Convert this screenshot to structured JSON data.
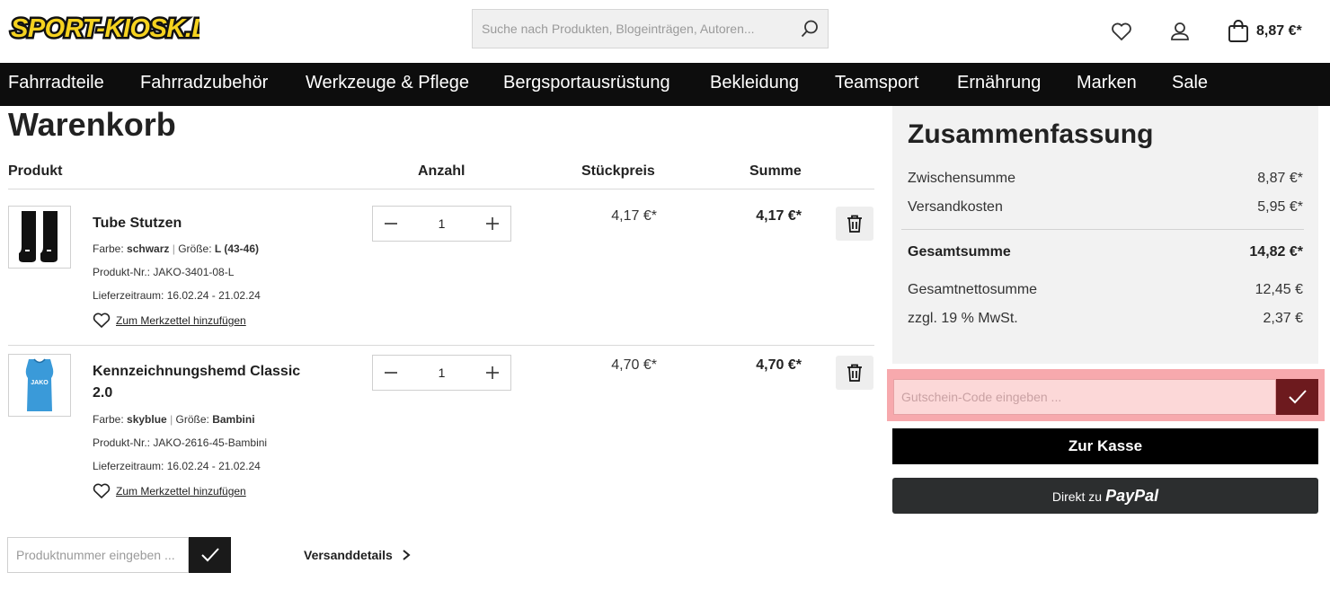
{
  "header": {
    "logo_text": "SPORT-KIOSK.DE",
    "search_placeholder": "Suche nach Produkten, Blogeinträgen, Autoren...",
    "cart_amount": "8,87 €*"
  },
  "nav": {
    "items": [
      "Fahrradteile",
      "Fahrradzubehör",
      "Werkzeuge & Pflege",
      "Bergsportausrüstung",
      "Bekleidung",
      "Teamsport",
      "Ernährung",
      "Marken",
      "Sale"
    ]
  },
  "cart": {
    "title": "Warenkorb",
    "columns": {
      "product": "Produkt",
      "quantity": "Anzahl",
      "unit_price": "Stückpreis",
      "total": "Summe"
    },
    "items": [
      {
        "name": "Tube Stutzen",
        "color_label": "Farbe:",
        "color": "schwarz",
        "size_label": "Größe:",
        "size": "L (43-46)",
        "product_no": "Produkt-Nr.: JAKO-3401-08-L",
        "delivery": "Lieferzeitraum: 16.02.24 - 21.02.24",
        "wishlist": "Zum Merkzettel hinzufügen",
        "quantity": "1",
        "unit_price": "4,17 €*",
        "total": "4,17 €*"
      },
      {
        "name": "Kennzeichnungshemd Classic 2.0",
        "color_label": "Farbe:",
        "color": "skyblue",
        "size_label": "Größe:",
        "size": "Bambini",
        "product_no": "Produkt-Nr.: JAKO-2616-45-Bambini",
        "delivery": "Lieferzeitraum: 16.02.24 - 21.02.24",
        "wishlist": "Zum Merkzettel hinzufügen",
        "quantity": "1",
        "unit_price": "4,70 €*",
        "total": "4,70 €*"
      }
    ],
    "product_number_placeholder": "Produktnummer eingeben ...",
    "shipping_details": "Versanddetails"
  },
  "summary": {
    "title": "Zusammenfassung",
    "subtotal_label": "Zwischensumme",
    "subtotal": "8,87 €*",
    "shipping_label": "Versandkosten",
    "shipping": "5,95 €*",
    "total_label": "Gesamtsumme",
    "total": "14,82 €*",
    "net_label": "Gesamtnettosumme",
    "net": "12,45 €",
    "vat_label": "zzgl. 19 % MwSt.",
    "vat": "2,37 €",
    "voucher_placeholder": "Gutschein-Code eingeben ...",
    "checkout_label": "Zur Kasse",
    "paypal_prefix": "Direkt zu",
    "paypal_brand": "PayPal"
  },
  "colors": {
    "logo_yellow": "#f5d21f",
    "nav_bg": "#0d0d0d",
    "highlight": "#f7a9ad",
    "voucher_btn": "#6d1a1e",
    "paypal_bg": "#2c2e2f",
    "shirt_blue": "#3a9ad9"
  }
}
